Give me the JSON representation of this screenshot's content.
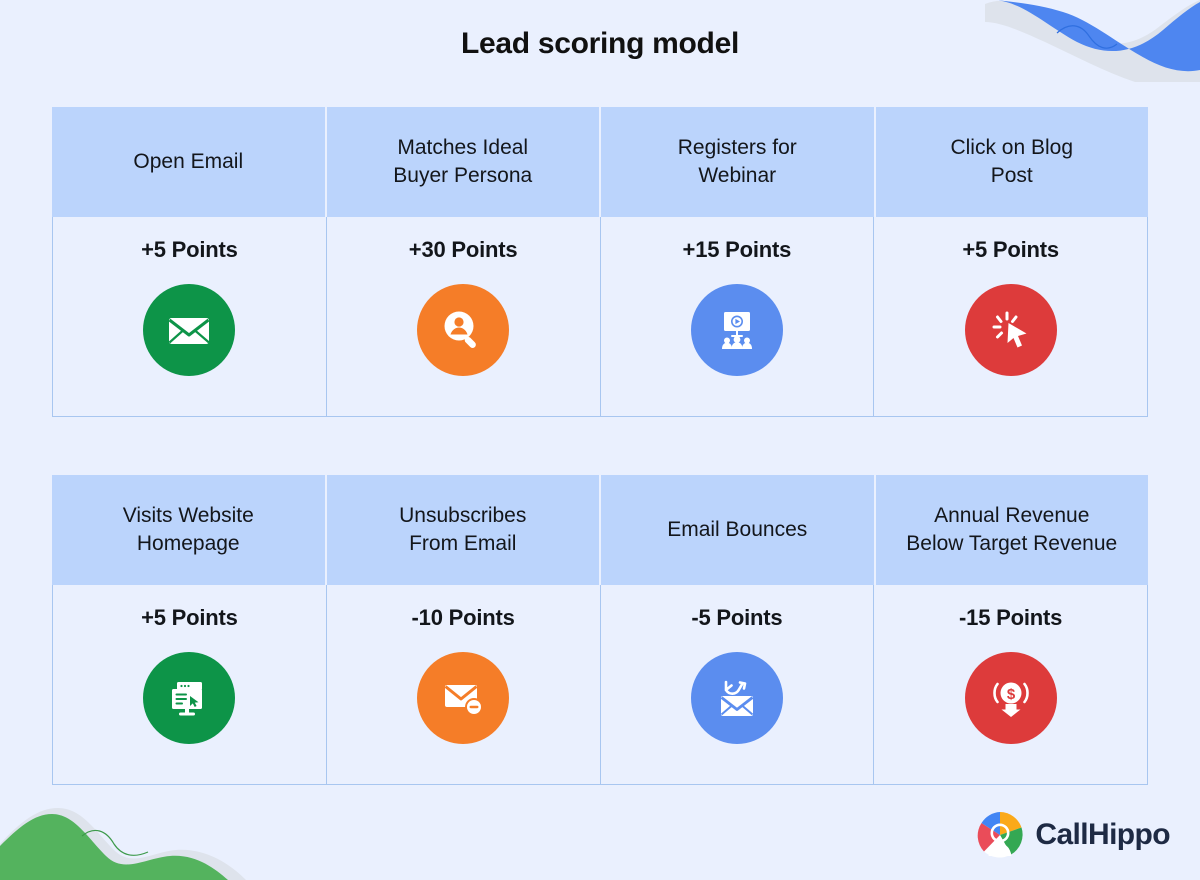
{
  "page": {
    "title": "Lead scoring model",
    "background_color": "#EAF0FE",
    "header_cell_color": "#BBD4FC",
    "divider_color": "#A8C6F0"
  },
  "decorations": {
    "top_right": {
      "name": "blue-wave-blob",
      "color": "#4E86F0",
      "band_color": "#DEE3EC",
      "line_color": "#2F6FE0"
    },
    "bottom_left": {
      "name": "green-wave-blob",
      "color": "#54B35E",
      "band_color": "#DEE3EC",
      "line_color": "#3C9A4A"
    }
  },
  "tables": [
    {
      "id": "positive-scores",
      "columns": [
        {
          "header": "Open Email",
          "points": "+5 Points",
          "icon": "envelope-icon",
          "icon_color": "#0D9448"
        },
        {
          "header": "Matches Ideal\nBuyer Persona",
          "header_line1": "Matches Ideal",
          "header_line2": "Buyer Persona",
          "points": "+30 Points",
          "icon": "person-search-icon",
          "icon_color": "#F57D28"
        },
        {
          "header": "Registers for\nWebinar",
          "header_line1": "Registers for",
          "header_line2": "Webinar",
          "points": "+15 Points",
          "icon": "webinar-presentation-icon",
          "icon_color": "#5B8DEF"
        },
        {
          "header": "Click on Blog\nPost",
          "header_line1": "Click on Blog",
          "header_line2": "Post",
          "points": "+5 Points",
          "icon": "click-cursor-icon",
          "icon_color": "#DD3B3B"
        }
      ]
    },
    {
      "id": "negative-scores",
      "columns": [
        {
          "header": "Visits Website\nHomepage",
          "header_line1": "Visits Website",
          "header_line2": "Homepage",
          "points": "+5 Points",
          "icon": "website-monitor-icon",
          "icon_color": "#0D9448"
        },
        {
          "header": "Unsubscribes\nFrom Email",
          "header_line1": "Unsubscribes",
          "header_line2": "From Email",
          "points": "-10 Points",
          "icon": "email-unsubscribe-icon",
          "icon_color": "#F57D28"
        },
        {
          "header": "Email Bounces",
          "points": "-5 Points",
          "icon": "email-bounce-icon",
          "icon_color": "#5B8DEF"
        },
        {
          "header": "Annual Revenue\nBelow Target Revenue",
          "header_line1": "Annual Revenue",
          "header_line2": "Below Target Revenue",
          "points": "-15 Points",
          "icon": "revenue-down-icon",
          "icon_color": "#DD3B3B"
        }
      ]
    }
  ],
  "brand": {
    "name": "CallHippo",
    "mark": "callhippo-logo-icon",
    "mark_colors": [
      "#4285F4",
      "#FBA919",
      "#34A853",
      "#EA4C59"
    ],
    "text_color": "#1E2A44"
  }
}
